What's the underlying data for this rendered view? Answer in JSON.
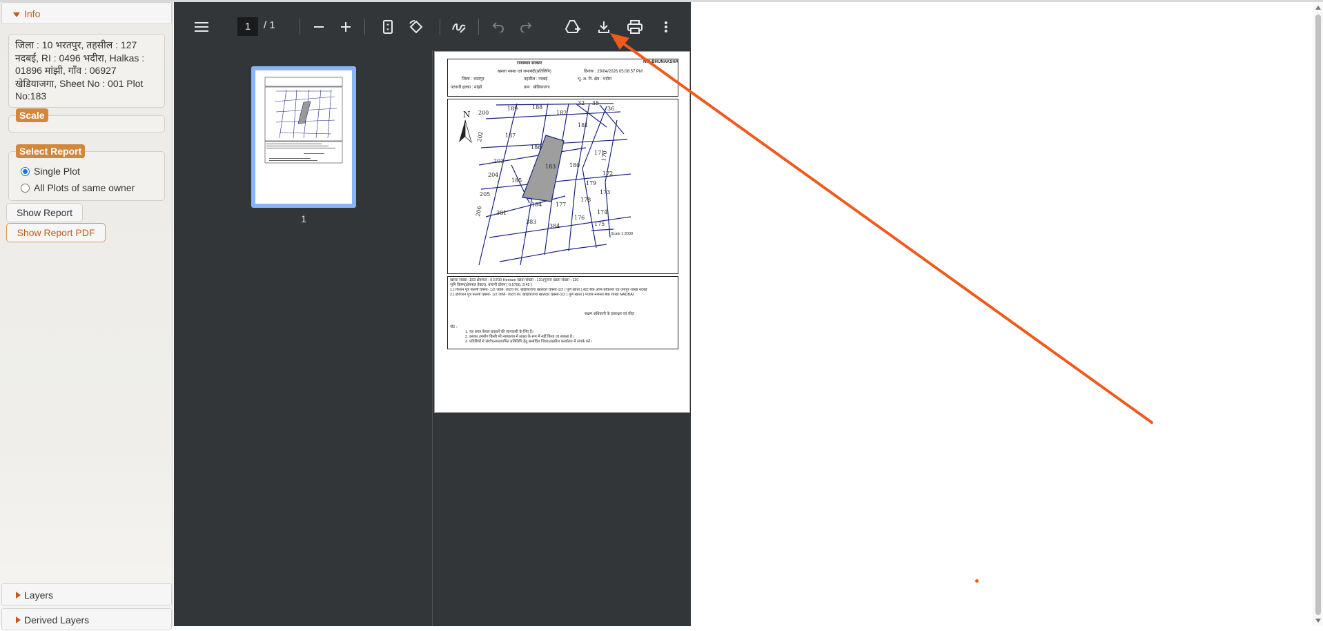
{
  "left_panel": {
    "info_header": "Info",
    "info_text": "जिला : 10 भरतपुर, तहसील : 127 नदबई, RI : 0496 भदीरा, Halkas : 01896 मांझी, गाँव : 06927 खेडियाजगा, Sheet No : 001 Plot No:183",
    "scale_legend": "Scale",
    "select_report_legend": "Select Report",
    "radio_single": "Single Plot",
    "radio_all": "All Plots of same owner",
    "show_report": "Show Report",
    "show_report_pdf": "Show Report PDF",
    "layers_header": "Layers",
    "derived_layers_header": "Derived Layers"
  },
  "pdf_toolbar": {
    "current_page": "1",
    "page_total": "/ 1",
    "icons": [
      "menu-icon",
      "zoom-out-icon",
      "zoom-in-icon",
      "fit-page-icon",
      "rotate-icon",
      "draw-icon",
      "undo-icon",
      "redo-icon",
      "drive-add-icon",
      "download-icon",
      "print-icon",
      "more-vert-icon"
    ]
  },
  "pdf_sidebar": {
    "thumbnail_label": "1"
  },
  "pdf_page": {
    "header_title": "राजस्थान सरकार",
    "header_right": "NIC-BHUNAKSHA",
    "header_line2": "खसरा नक्शा एवं जमाबंदी(प्रतिलिपि)",
    "date": "दिनांक : 29/04/2026 05:08:57 PM",
    "district": "जिला : भरतपुर",
    "tehsil": "तहसील : नदबई",
    "ri": "भू. अ. नि. क्षेत्र : भदीरा",
    "patwar": "पटवारी हल्का : मांझी",
    "village": "ग्राम : खेडियाजगा",
    "north": "N",
    "scale": "Scale 1:2000",
    "plots": [
      "189",
      "188",
      "182",
      "181",
      "200",
      "187",
      "186",
      "183",
      "180",
      "171",
      "202",
      "203",
      "185",
      "204",
      "179",
      "172",
      "205",
      "184",
      "177",
      "178",
      "173",
      "206",
      "381",
      "383",
      "384",
      "176",
      "174",
      "175",
      "35",
      "36",
      "32",
      "170"
    ],
    "info_line1": "खसरा संख्या :183 क्षेत्रफल : 0.5700 Hectare  खाता संख्या : 131(पुराना खाता संख्या : 110",
    "info_line2": "भूमि किस्म(क्षेत्रफल हेक्टर): बारानी दोयम [ 0.5700, 3.42 ]",
    "info_line3": "1.) किशन पुत्र फल्ली   हिस्सा- 1/2 जाति- जाटव का. खेड़ियाजगा खातेदार  हिस्सा-1/2 ( पूर्ण खाता )  स्टेट बैंक ऑफ बीकानेर एंड जयपुर शाखा नदबई",
    "info_line4": "2.) हरिचरन पुत्र फल्ली   हिस्सा- 1/2 जाति- जाटव का. खेड़ियाजगा खातेदार  हिस्सा-1/2 ( पूर्ण खाता )  पंजाब नेशनल बैंक शाखा NADBAI",
    "signature": "सक्षम अधिकारी के हस्ताक्षर एवं सील",
    "note_label": "नोट :-",
    "note1": "1. यह प्रपत्र केवल ग्राहकों की जानकारी के लिए है।",
    "note2": "2. इसका उपयोग किसी भी न्यायालय में साक्ष्य के रूप में नहीं किया जा सकता है।",
    "note3": "3. प्रविष्टियों में संशोधन/सत्यापित प्रतिलिपि  हेतु सम्बंधित जिला/तहसील कार्यालय में संपर्क करें।"
  },
  "annotation": {
    "arrow_color": "#f05a1a"
  }
}
